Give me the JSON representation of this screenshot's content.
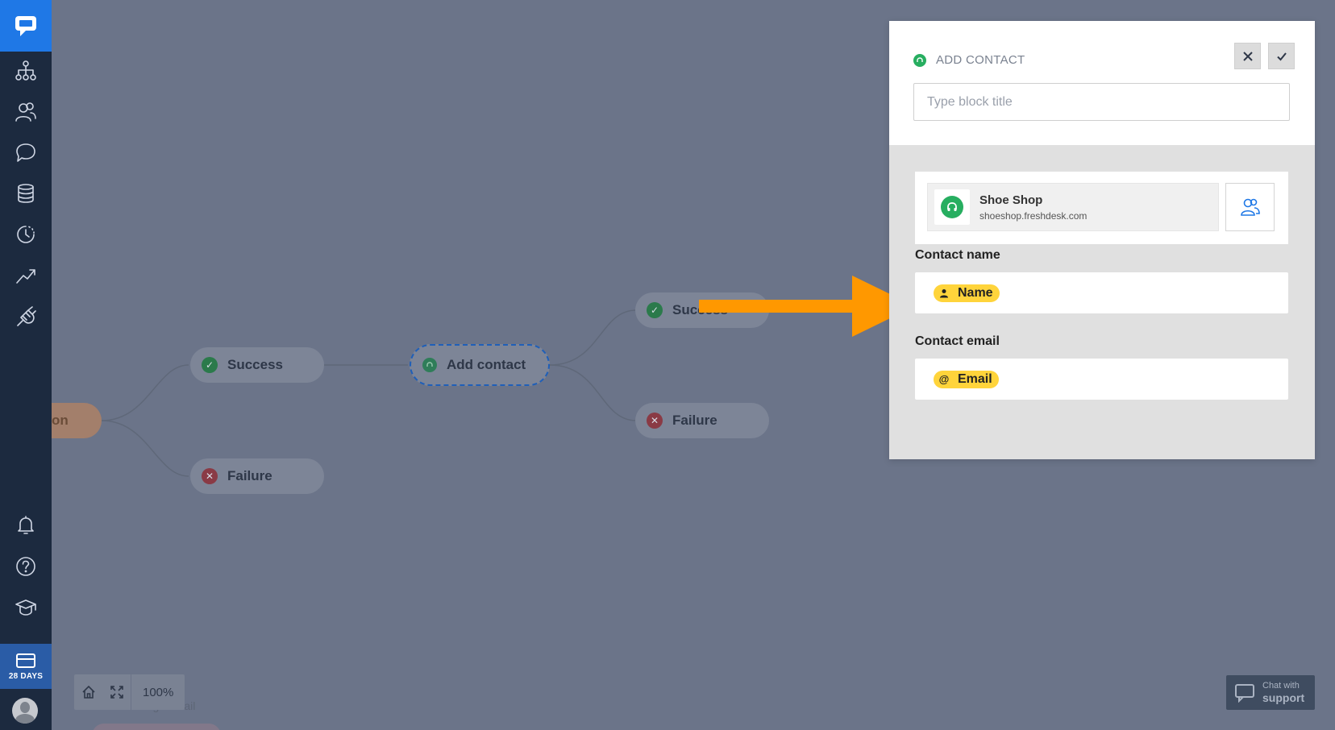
{
  "sidebar": {
    "logo_icon": "chat-bubble-icon",
    "nav": [
      {
        "icon": "flow-tree-icon"
      },
      {
        "icon": "users-icon"
      },
      {
        "icon": "chat-icon"
      },
      {
        "icon": "database-icon"
      },
      {
        "icon": "history-icon"
      },
      {
        "icon": "trend-chart-icon"
      },
      {
        "icon": "plug-icon"
      }
    ],
    "bottom": [
      {
        "icon": "bell-icon"
      },
      {
        "icon": "help-icon"
      },
      {
        "icon": "graduation-cap-icon"
      }
    ],
    "trial_label": "28 DAYS"
  },
  "canvas": {
    "partial_node_label": "on",
    "nodes": {
      "success_left": "Success",
      "failure_left": "Failure",
      "add_contact": "Add contact",
      "success_right": "Success",
      "failure_right": "Failure"
    },
    "zoom": "100%",
    "faint_text": "Change email"
  },
  "panel": {
    "title": "ADD CONTACT",
    "title_input_placeholder": "Type block title",
    "account": {
      "name": "Shoe Shop",
      "domain": "shoeshop.freshdesk.com"
    },
    "fields": [
      {
        "label": "Contact name",
        "tag": "Name",
        "tag_icon": "person-icon"
      },
      {
        "label": "Contact email",
        "tag": "Email",
        "tag_icon": "at-icon"
      }
    ]
  },
  "chat_widget": {
    "line1": "Chat with",
    "line2": "support"
  },
  "colors": {
    "accent": "#1f78e6",
    "sidebar": "#1c2a3f",
    "tag": "#ffd43b",
    "arrow": "#ff9800",
    "freshdesk_green": "#27ae60"
  }
}
